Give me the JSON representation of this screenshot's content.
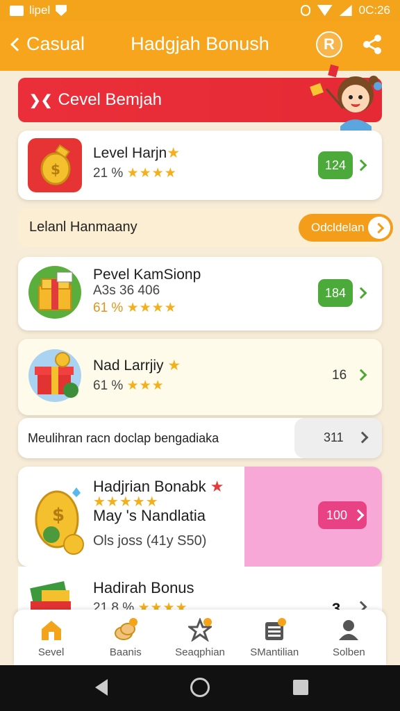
{
  "status_bar": {
    "app": "lipel",
    "time": "0C:26"
  },
  "header": {
    "back_label": "Casual",
    "title": "Hadgjah Bonush",
    "help_glyph": "R"
  },
  "banner": {
    "chip": "❯❮",
    "text": "Cevel Bemjah"
  },
  "card1": {
    "title": "Level Harjn",
    "rating_text": "21 %",
    "stars": "★★★★",
    "badge": "124",
    "badge_color": "#4caa3a"
  },
  "promo": {
    "text": "Lelanl Hanmaany",
    "button": "Odcldelan"
  },
  "card2": {
    "title": "Pevel KamSionp",
    "subtitle": "A3s 36 406",
    "rating_text": "61 %",
    "stars": "★★★★",
    "badge": "184"
  },
  "card3": {
    "title": "Nad Larrjiy",
    "rating_text": "61 %",
    "stars": "★★★",
    "value": "16"
  },
  "row": {
    "text": "Meulihran racn doclap bengadiaka",
    "value": "311"
  },
  "card4": {
    "title": "Hadjrian Bonabk",
    "stars": "★★★★★",
    "subtitle": "May 's Nandlatia",
    "detail": "Ols joss (41y S50)",
    "badge": "100",
    "highlight_color": "#f7a8d6",
    "badge_color": "#e84284"
  },
  "card5": {
    "title": "Hadirah Bonus",
    "rating_text": "21.8 %",
    "stars": "★★★★",
    "value": "3"
  },
  "bottom_nav": [
    {
      "label": "Sevel",
      "icon": "home-icon"
    },
    {
      "label": "Baanis",
      "icon": "coins-icon"
    },
    {
      "label": "Seaqphian",
      "icon": "star-icon"
    },
    {
      "label": "SMantilian",
      "icon": "list-icon"
    },
    {
      "label": "Solben",
      "icon": "profile-icon"
    }
  ]
}
